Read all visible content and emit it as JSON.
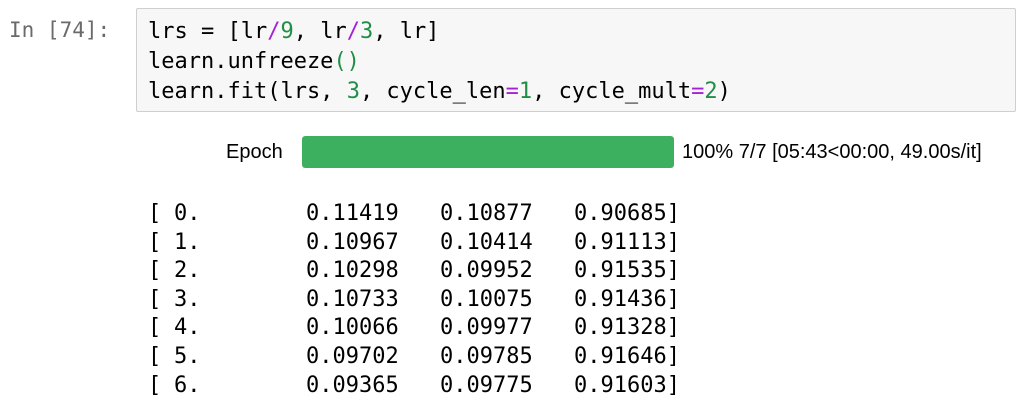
{
  "cell": {
    "prompt": "In [74]:",
    "lines": [
      [
        {
          "t": "lrs = [lr"
        },
        {
          "t": "/",
          "c": "op"
        },
        {
          "t": "9",
          "c": "num"
        },
        {
          "t": ", lr"
        },
        {
          "t": "/",
          "c": "op"
        },
        {
          "t": "3",
          "c": "num"
        },
        {
          "t": ", lr]"
        }
      ],
      [
        {
          "t": "learn.unfreeze"
        },
        {
          "t": "()",
          "c": "paren"
        }
      ],
      [
        {
          "t": "learn.fit(lrs, "
        },
        {
          "t": "3",
          "c": "num"
        },
        {
          "t": ", cycle_len"
        },
        {
          "t": "=",
          "c": "op"
        },
        {
          "t": "1",
          "c": "num"
        },
        {
          "t": ", cycle_mult"
        },
        {
          "t": "=",
          "c": "op"
        },
        {
          "t": "2",
          "c": "num"
        },
        {
          "t": ")"
        }
      ]
    ]
  },
  "progress": {
    "label": "Epoch",
    "fraction": 1.0,
    "text": "100% 7/7 [05:43<00:00, 49.00s/it]",
    "color": "#3cb05e"
  },
  "output": {
    "rows": [
      [
        "[",
        "0.",
        "0.11419",
        "0.10877",
        "0.90685]"
      ],
      [
        "[",
        "1.",
        "0.10967",
        "0.10414",
        "0.91113]"
      ],
      [
        "[",
        "2.",
        "0.10298",
        "0.09952",
        "0.91535]"
      ],
      [
        "[",
        "3.",
        "0.10733",
        "0.10075",
        "0.91436]"
      ],
      [
        "[",
        "4.",
        "0.10066",
        "0.09977",
        "0.91328]"
      ],
      [
        "[",
        "5.",
        "0.09702",
        "0.09785",
        "0.91646]"
      ],
      [
        "[",
        "6.",
        "0.09365",
        "0.09775",
        "0.91603]"
      ]
    ]
  }
}
